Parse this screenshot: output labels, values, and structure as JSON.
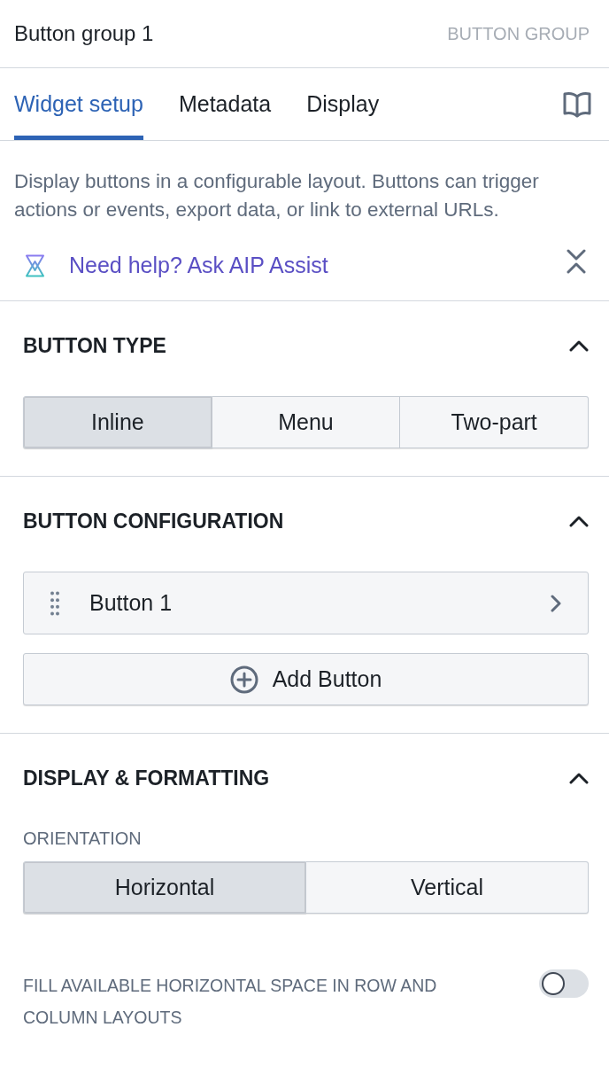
{
  "header": {
    "title": "Button group 1",
    "type_label": "BUTTON GROUP"
  },
  "tabs": [
    {
      "label": "Widget setup",
      "selected": true
    },
    {
      "label": "Metadata",
      "selected": false
    },
    {
      "label": "Display",
      "selected": false
    }
  ],
  "description": "Display buttons in a configurable layout. Buttons can trigger actions or events, export data, or link to external URLs.",
  "assist_link": {
    "label": "Need help? Ask AIP Assist"
  },
  "sections": [
    {
      "title": "BUTTON TYPE",
      "expanded": true,
      "controls": [
        {
          "kind": "segmented",
          "options": [
            {
              "label": "Inline",
              "selected": true
            },
            {
              "label": "Menu",
              "selected": false
            },
            {
              "label": "Two-part",
              "selected": false
            }
          ]
        }
      ]
    },
    {
      "title": "BUTTON CONFIGURATION",
      "expanded": true,
      "controls": [
        {
          "kind": "list",
          "items": [
            {
              "label": "Button 1"
            }
          ]
        },
        {
          "kind": "add_button",
          "label": "Add Button"
        }
      ]
    },
    {
      "title": "DISPLAY & FORMATTING",
      "expanded": true,
      "controls": [
        {
          "kind": "segmented",
          "label": "ORIENTATION",
          "options": [
            {
              "label": "Horizontal",
              "selected": true
            },
            {
              "label": "Vertical",
              "selected": false
            }
          ]
        },
        {
          "kind": "toggle",
          "label": "FILL AVAILABLE HORIZONTAL SPACE IN ROW AND COLUMN LAYOUTS",
          "on": false
        }
      ]
    }
  ]
}
